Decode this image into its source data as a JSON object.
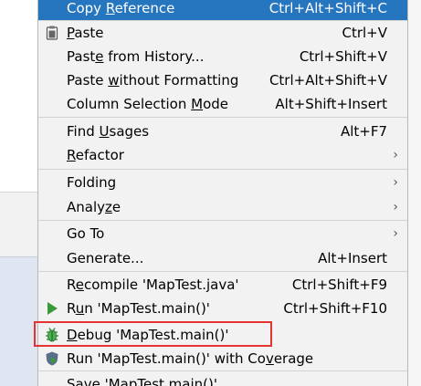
{
  "menu": {
    "items": [
      {
        "pre": "Copy ",
        "u": "R",
        "post": "eference",
        "shortcut": "Ctrl+Alt+Shift+C"
      },
      {
        "pre": "",
        "u": "P",
        "post": "aste",
        "shortcut": "Ctrl+V"
      },
      {
        "pre": "Past",
        "u": "e",
        "post": " from History...",
        "shortcut": "Ctrl+Shift+V"
      },
      {
        "pre": "Paste ",
        "u": "w",
        "post": "ithout Formatting",
        "shortcut": "Ctrl+Alt+Shift+V"
      },
      {
        "pre": "Column Selection ",
        "u": "M",
        "post": "ode",
        "shortcut": "Alt+Shift+Insert"
      },
      {
        "pre": "Find ",
        "u": "U",
        "post": "sages",
        "shortcut": "Alt+F7"
      },
      {
        "pre": "",
        "u": "R",
        "post": "efactor",
        "shortcut": ""
      },
      {
        "pre": "Folding",
        "u": "",
        "post": "",
        "shortcut": ""
      },
      {
        "pre": "Analy",
        "u": "z",
        "post": "e",
        "shortcut": ""
      },
      {
        "pre": "Go To",
        "u": "",
        "post": "",
        "shortcut": ""
      },
      {
        "pre": "Generate...",
        "u": "",
        "post": "",
        "shortcut": "Alt+Insert"
      },
      {
        "pre": "R",
        "u": "e",
        "post": "compile 'MapTest.java'",
        "shortcut": "Ctrl+Shift+F9"
      },
      {
        "pre": "R",
        "u": "u",
        "post": "n 'MapTest.main()'",
        "shortcut": "Ctrl+Shift+F10"
      },
      {
        "pre": "",
        "u": "D",
        "post": "ebug 'MapTest.main()'",
        "shortcut": ""
      },
      {
        "pre": "Run 'MapTest.main()' with Co",
        "u": "v",
        "post": "erage",
        "shortcut": ""
      },
      {
        "pre": "Save 'MapTest.main()'",
        "u": "",
        "post": "",
        "shortcut": ""
      }
    ],
    "submenu_arrow": "›"
  },
  "icons": {
    "paste": "clipboard-icon",
    "run": "run-play-icon",
    "debug": "debug-bug-icon",
    "coverage": "coverage-shield-icon"
  },
  "colors": {
    "selection": "#2675bf",
    "menu_bg": "#f2f2f2",
    "run_green": "#3a9a3a",
    "highlight_red": "#e53333"
  }
}
